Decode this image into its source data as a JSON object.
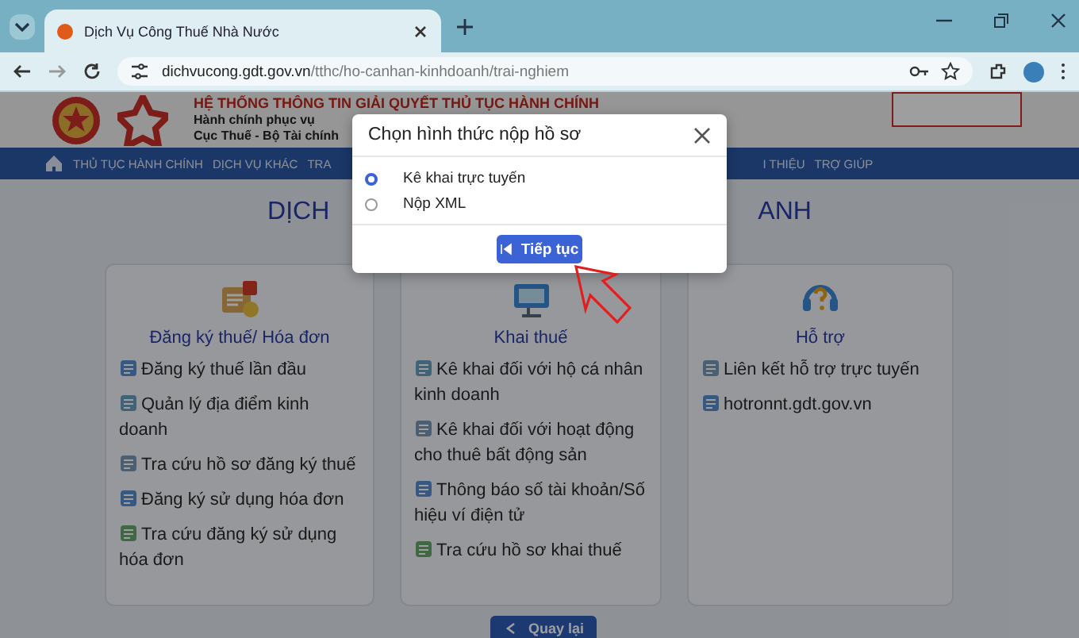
{
  "browser": {
    "tab_title": "Dịch Vụ Công Thuế Nhà Nước",
    "url_host": "dichvucong.gdt.gov.vn",
    "url_path": "/tthc/ho-canhan-kinhdoanh/trai-nghiem"
  },
  "header": {
    "title": "HỆ THỐNG THÔNG TIN GIẢI QUYẾT THỦ TỤC HÀNH CHÍNH",
    "subtitle_1": "Hành chính phục vụ",
    "subtitle_2": "Cục Thuế - Bộ Tài chính"
  },
  "nav": {
    "left_items": [
      "THỦ TỤC HÀNH CHÍNH",
      "DỊCH VỤ KHÁC",
      "TRA"
    ],
    "right_items": [
      "I THIỆU",
      "TRỢ GIÚP"
    ]
  },
  "heading": {
    "left": "DỊCH",
    "right": "ANH"
  },
  "cards": [
    {
      "title": "Đăng ký thuế/ Hóa đơn",
      "links": [
        "Đăng ký thuế lần đầu",
        "Quản lý địa điểm kinh doanh",
        "Tra cứu hồ sơ đăng ký thuế",
        "Đăng ký sử dụng hóa đơn",
        "Tra cứu đăng ký sử dụng hóa đơn"
      ]
    },
    {
      "title": "Khai thuế",
      "links": [
        "Kê khai đối với hộ cá nhân kinh doanh",
        "Kê khai đối với hoạt động cho thuê bất động sản",
        "Thông báo số tài khoản/Số hiệu ví điện tử",
        "Tra cứu hồ sơ khai thuế"
      ]
    },
    {
      "title": "Hỗ trợ",
      "links": [
        "Liên kết hỗ trợ trực tuyến",
        "hotronnt.gdt.gov.vn"
      ]
    }
  ],
  "back_button": "Quay lại",
  "dialog": {
    "title": "Chọn hình thức nộp hồ sơ",
    "options": [
      {
        "label": "Kê khai trực tuyến",
        "selected": true
      },
      {
        "label": "Nộp XML",
        "selected": false
      }
    ],
    "button": "Tiếp tục"
  }
}
